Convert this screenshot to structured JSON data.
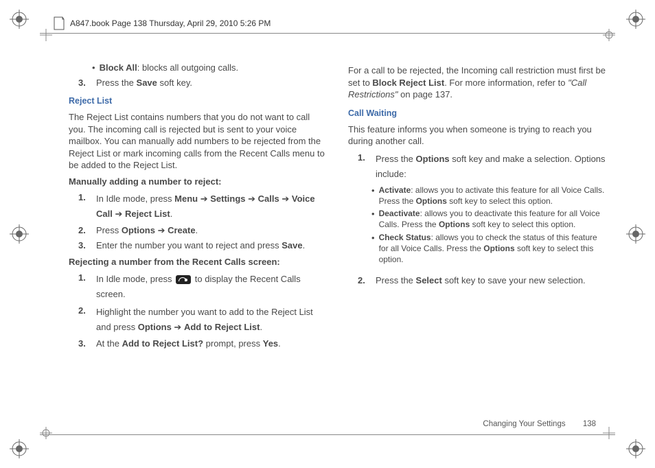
{
  "header": {
    "text": "A847.book  Page 138  Thursday, April 29, 2010  5:26 PM"
  },
  "left": {
    "blockall_label": "Block All",
    "blockall_desc": ": blocks all outgoing calls.",
    "step3_a": "Press the ",
    "step3_bold": "Save",
    "step3_b": " soft key.",
    "h_reject": "Reject List",
    "reject_para": "The Reject List contains numbers that you do not want to call you. The incoming call is rejected but is sent to your voice mailbox. You can manually add numbers to be rejected from the Reject List or mark incoming calls from the Recent Calls menu to be added to the Reject List.",
    "h_manual": "Manually adding a number to reject:",
    "m1_a": "In Idle mode, press ",
    "m1_b1": "Menu",
    "m1_arr1": " ➔ ",
    "m1_b2": "Settings",
    "m1_arr2": " ➔ ",
    "m1_b3": "Calls",
    "m1_arr3": " ➔ ",
    "m1_b4": "Voice Call",
    "m1_arr4": " ➔ ",
    "m1_b5": "Reject List",
    "m1_end": ".",
    "m2_a": "Press ",
    "m2_b1": "Options",
    "m2_arr": " ➔ ",
    "m2_b2": "Create",
    "m2_end": ".",
    "m3_a": "Enter the number you want to reject and press ",
    "m3_b": "Save",
    "m3_end": ".",
    "h_recent": "Rejecting a number from the Recent Calls screen:",
    "r1_a": "In Idle mode, press ",
    "r1_b": " to display the Recent Calls screen.",
    "r2_a": "Highlight the number you want to add to the Reject List and press ",
    "r2_b1": "Options",
    "r2_arr": " ➔ ",
    "r2_b2": "Add to Reject List",
    "r2_end": ".",
    "r3_a": "At the ",
    "r3_b": "Add to Reject List?",
    "r3_c": " prompt, press ",
    "r3_d": "Yes",
    "r3_end": "."
  },
  "right": {
    "intro_a": "For a call to be rejected, the Incoming call restriction must first be set to ",
    "intro_b": "Block Reject List",
    "intro_c": ". For more information, refer to ",
    "intro_ref": "\"Call Restrictions\"",
    "intro_d": "  on page 137.",
    "h_cw": "Call Waiting",
    "cw_para": "This feature informs you when someone is trying to reach you during another call.",
    "cw1_a": "Press the ",
    "cw1_b": "Options",
    "cw1_c": " soft key and make a selection. Options include:",
    "opt_act_label": "Activate",
    "opt_act_a": ": allows you to activate this feature for all Voice Calls. Press the ",
    "opt_act_b": "Options",
    "opt_act_c": " soft key to select this option.",
    "opt_de_label": "Deactivate",
    "opt_de_a": ": allows you to deactivate this feature for all Voice Calls. Press the ",
    "opt_de_b": "Options",
    "opt_de_c": " soft key to select this option.",
    "opt_cs_label": "Check Status",
    "opt_cs_a": ": allows you to check the status of this feature for all Voice Calls. Press the ",
    "opt_cs_b": "Options",
    "opt_cs_c": " soft key to select this option.",
    "cw2_a": "Press the ",
    "cw2_b": "Select",
    "cw2_c": " soft key to save your new selection."
  },
  "footer": {
    "section": "Changing Your Settings",
    "page": "138"
  }
}
